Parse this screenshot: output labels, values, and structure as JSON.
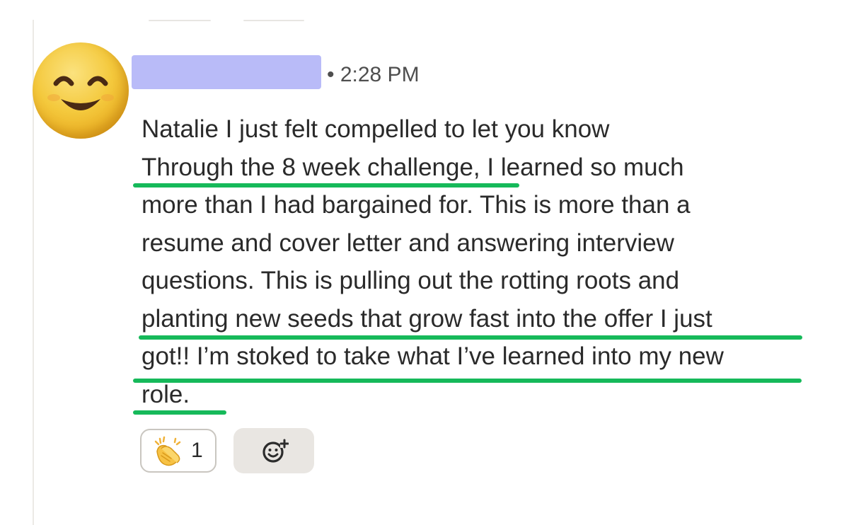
{
  "post": {
    "timestamp": "• 2:28 PM",
    "message_lines": [
      "Natalie I just felt compelled to let you know",
      "Through the 8 week challenge, I learned so much",
      "more than I had bargained for. This is more than a",
      "resume and cover letter and answering interview",
      "questions. This is pulling out the rotting roots and",
      "planting new seeds that grow fast into the offer I just",
      "got!! I’m stoked to take what I’ve learned into my new",
      "role."
    ]
  },
  "reactions": [
    {
      "icon": "clapping-hands-icon",
      "count": "1"
    }
  ],
  "add_reaction": {
    "icon": "add-emoji-icon"
  },
  "colors": {
    "underline": "#16b95a",
    "name_redaction": "#b9bbf8",
    "text": "#2a2a2a",
    "timestamp": "#4e4e4e",
    "add_reaction_bg": "#e9e6e2"
  }
}
